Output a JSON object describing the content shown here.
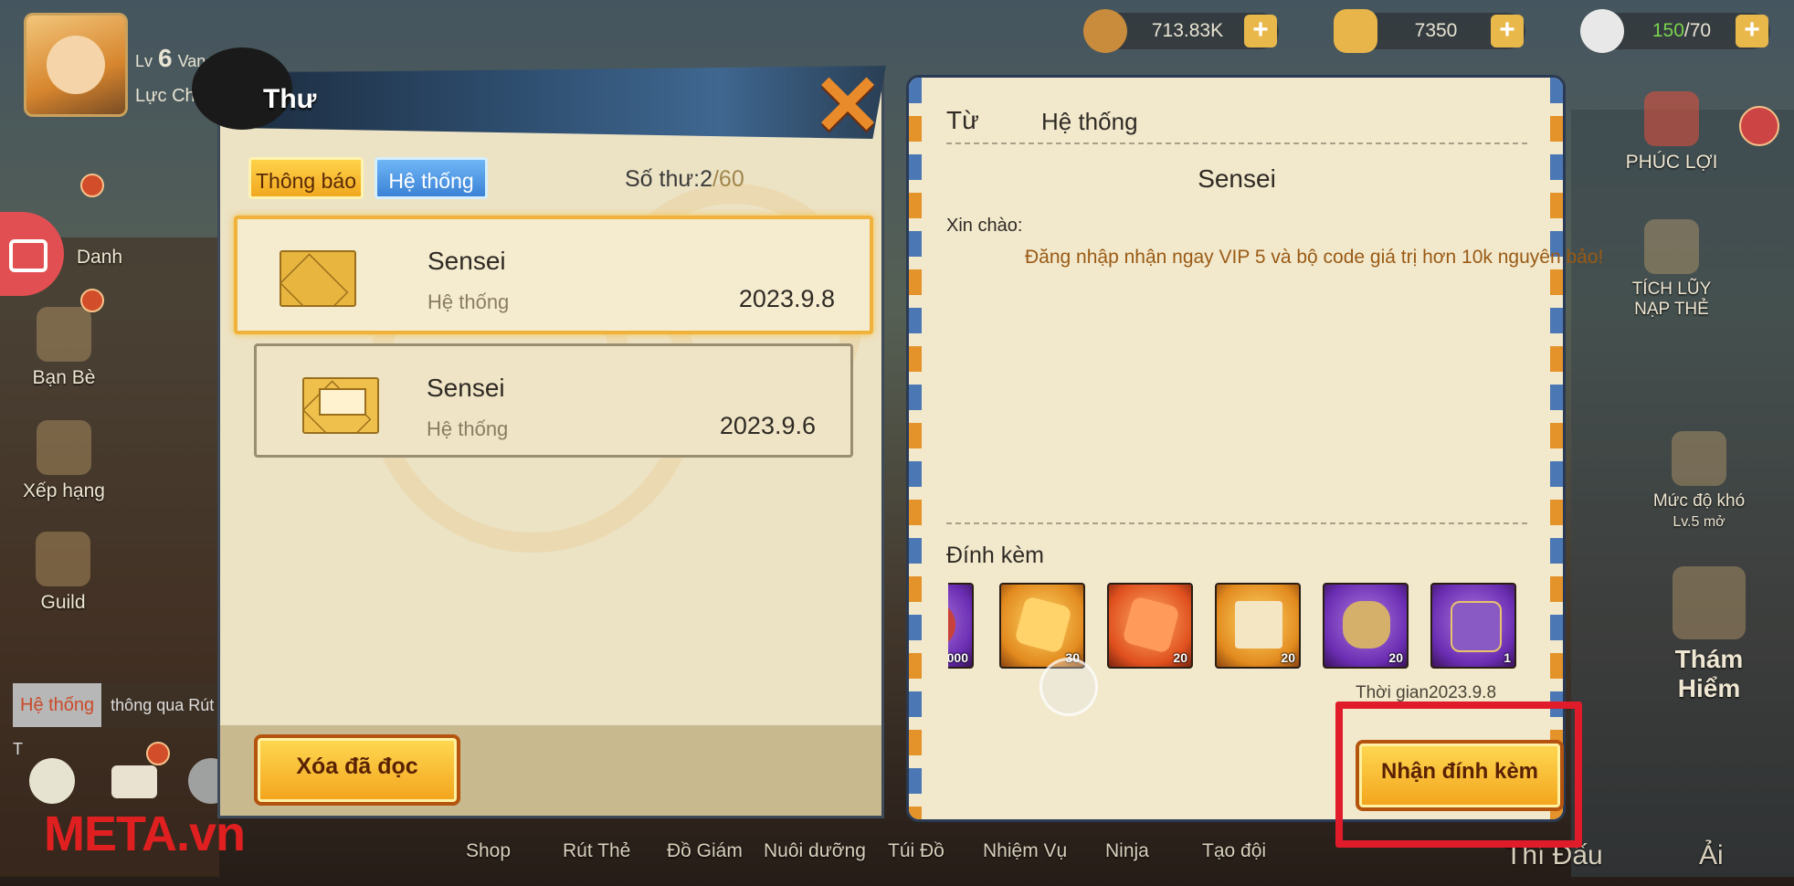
{
  "player": {
    "level_prefix": "Lv",
    "level": "6",
    "name": "Vanes Primro",
    "power_label": "Lực Chiến"
  },
  "resources": [
    {
      "value": "713.83K",
      "icon": "coin-icon",
      "color": "#c98b3c"
    },
    {
      "value": "7350",
      "icon": "gold-bar-icon",
      "color": "#e8b54a"
    },
    {
      "value_current": "150",
      "value_max": "/70",
      "icon": "rice-ball-icon",
      "color": "#e8e8e8"
    }
  ],
  "plus_label": "+",
  "left_menu": [
    "Danh",
    "Bạn Bè",
    "Xếp hạng",
    "Guild"
  ],
  "right_menu": [
    "PHÚC LỢI",
    "TÍCH LŨY NẠP THẺ",
    "Mức độ khó",
    "Lv.5 mở",
    "Thám Hiểm"
  ],
  "chat_notice": {
    "tag": "Hệ thống",
    "text": "thông qua Rút T"
  },
  "watermark": "META.vn",
  "bottom_nav": [
    "Shop",
    "Rút Thẻ",
    "Đồ Giám",
    "Nuôi dưỡng",
    "Túi Đồ",
    "Nhiệm Vụ",
    "Ninja",
    "Tạo đội",
    "Thí Đấu",
    "Ải"
  ],
  "mail_panel": {
    "title": "Thư",
    "close_glyph": "✕",
    "tabs": [
      {
        "label": "Thông báo",
        "active": true
      },
      {
        "label": "Hệ thống",
        "active": false
      }
    ],
    "count_label": "Số thư:",
    "count_current": "2",
    "count_max": "/60",
    "mails": [
      {
        "sender": "Sensei",
        "source": "Hệ thống",
        "date": "2023.9.8",
        "selected": true,
        "icon": "envelope-closed-icon"
      },
      {
        "sender": "Sensei",
        "source": "Hệ thống",
        "date": "2023.9.6",
        "selected": false,
        "icon": "envelope-open-icon"
      }
    ],
    "delete_read_label": "Xóa đã đọc"
  },
  "detail_panel": {
    "from_label": "Từ",
    "from_value": "Hệ thống",
    "sender": "Sensei",
    "greeting": "Xin chào:",
    "body": "Đăng nhập nhận ngay VIP 5 và bộ code giá trị hơn 10k nguyên bảo!",
    "attachments_label": "Đính kèm",
    "attachments": [
      {
        "qty": "000",
        "icon": "pouch-icon",
        "tier": "purple"
      },
      {
        "qty": "30",
        "icon": "puzzle-gold-icon",
        "tier": "gold"
      },
      {
        "qty": "20",
        "icon": "puzzle-red-icon",
        "tier": "red"
      },
      {
        "qty": "20",
        "icon": "scroll-icon",
        "tier": "gold"
      },
      {
        "qty": "20",
        "icon": "ore-bag-icon",
        "tier": "purple"
      },
      {
        "qty": "1",
        "icon": "chest-icon",
        "tier": "purple"
      }
    ],
    "time_label": "Thời gian2023.9.8",
    "claim_label": "Nhận đính kèm"
  }
}
